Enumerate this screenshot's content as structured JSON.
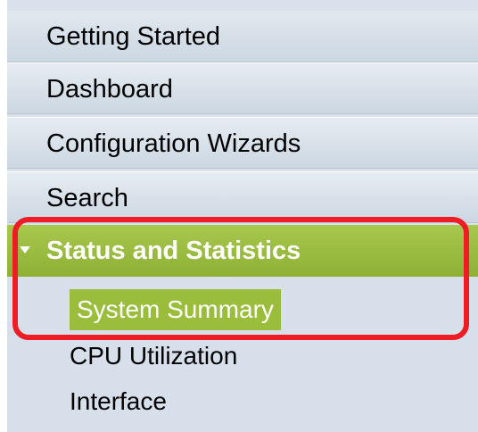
{
  "nav": {
    "items": [
      {
        "label": "Getting Started"
      },
      {
        "label": "Dashboard"
      },
      {
        "label": "Configuration Wizards"
      },
      {
        "label": "Search"
      }
    ],
    "section": {
      "label": "Status and Statistics",
      "expanded": true,
      "children": [
        {
          "label": "System Summary",
          "selected": true
        },
        {
          "label": "CPU Utilization"
        },
        {
          "label": "Interface"
        }
      ]
    }
  },
  "colors": {
    "section_header": "#9bbd3c",
    "highlight_box": "#ee1c24",
    "nav_background": "#d9e2ec"
  }
}
